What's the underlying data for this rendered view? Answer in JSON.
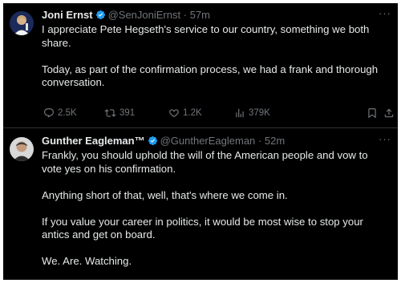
{
  "tweets": [
    {
      "name": "Joni Ernst",
      "handle": "@SenJoniErnst",
      "separator": "·",
      "time": "57m",
      "more": "···",
      "text": "I appreciate Pete Hegseth's service to our country, something we both share.\n\nToday, as part of the confirmation process, we had a frank and thorough conversation.",
      "stats": {
        "replies": "2.5K",
        "reposts": "391",
        "likes": "1.2K",
        "views": "379K"
      }
    },
    {
      "name": "Gunther Eagleman™",
      "handle": "@GuntherEagleman",
      "separator": "·",
      "time": "52m",
      "more": "···",
      "text": "Frankly, you should uphold the will of the American people and vow to vote yes on his confirmation.\n\nAnything short of that, well, that's where we come in.\n\nIf you value your career in politics, it would be most wise to stop your antics and get on board.\n\nWe. Are. Watching."
    }
  ],
  "colors": {
    "background": "#000000",
    "text": "#e7e9ea",
    "muted": "#71767b",
    "verified": "#1d9bf0",
    "divider": "#2f3336"
  },
  "icons": [
    "verified-badge-icon",
    "reply-icon",
    "repost-icon",
    "like-icon",
    "views-icon",
    "bookmark-icon",
    "share-icon",
    "more-icon"
  ]
}
